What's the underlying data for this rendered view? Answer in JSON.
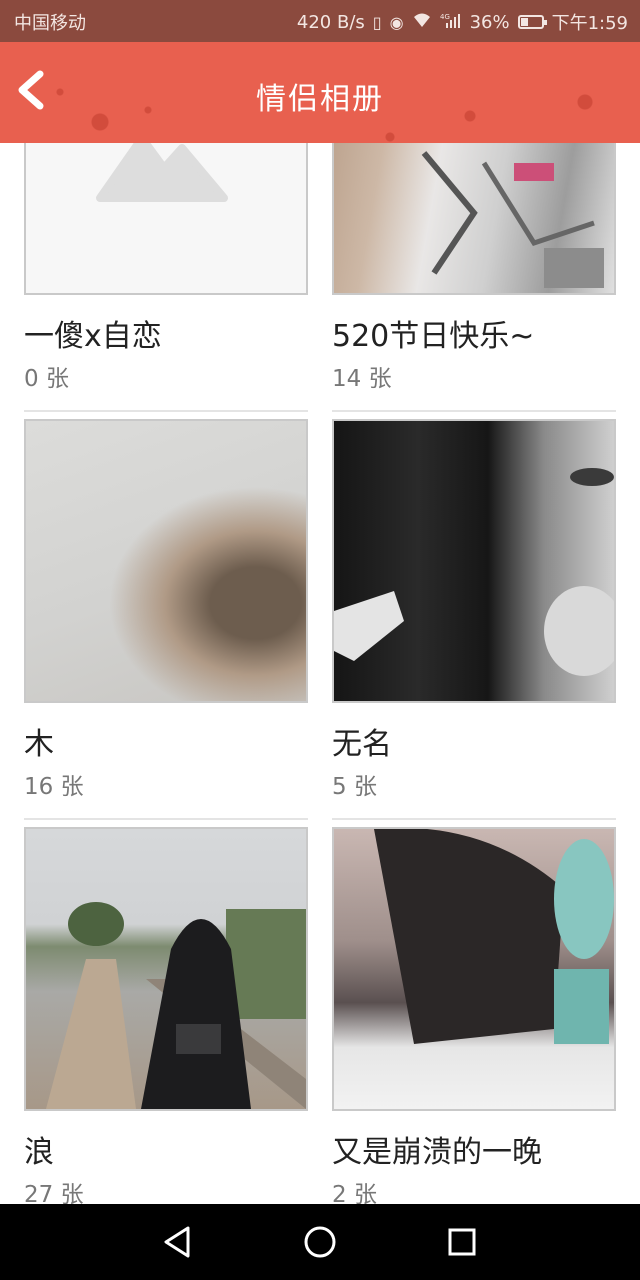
{
  "status_bar": {
    "carrier": "中国移动",
    "speed": "420 B/s",
    "network": "4G",
    "battery": "36%",
    "battery_level": 0.36,
    "time": "下午1:59",
    "icons": [
      "vibrate-icon",
      "eye-icon",
      "wifi-icon",
      "signal-icon",
      "battery-icon"
    ]
  },
  "header": {
    "title": "情侣相册",
    "back_icon": "chevron-left-icon",
    "color": "#e8604f"
  },
  "albums": [
    {
      "name": "一傻x自恋",
      "count": "0 张",
      "thumbnail": "placeholder-image-icon"
    },
    {
      "name": "520节日快乐~",
      "count": "14 张",
      "thumbnail": "photo"
    },
    {
      "name": "木",
      "count": "16 张",
      "thumbnail": "photo"
    },
    {
      "name": "无名",
      "count": "5 张",
      "thumbnail": "photo"
    },
    {
      "name": "浪",
      "count": "27 张",
      "thumbnail": "photo"
    },
    {
      "name": "又是崩溃的一晚",
      "count": "2 张",
      "thumbnail": "photo"
    }
  ],
  "nav_bar": {
    "buttons": [
      "back-triangle-icon",
      "home-circle-icon",
      "recents-square-icon"
    ]
  }
}
